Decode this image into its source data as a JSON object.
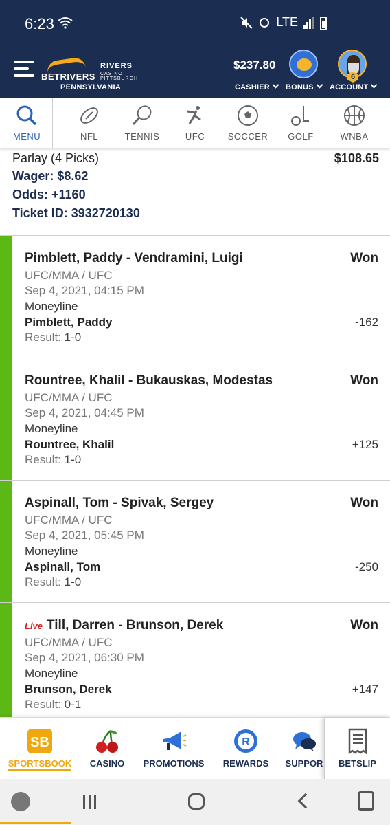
{
  "status_bar": {
    "time": "6:23",
    "network": "LTE"
  },
  "header": {
    "brand": "BETRIVERS",
    "partner_name": "RIVERS",
    "partner_sub": "CASINO PITTSBURGH",
    "state": "PENNSYLVANIA",
    "balance": "$237.80",
    "cashier_label": "CASHIER",
    "bonus_label": "BONUS",
    "account_label": "ACCOUNT",
    "level": "6"
  },
  "sport_nav": [
    {
      "label": "MENU",
      "icon": "search-icon"
    },
    {
      "label": "NFL",
      "icon": "football-icon"
    },
    {
      "label": "TENNIS",
      "icon": "tennis-icon"
    },
    {
      "label": "UFC",
      "icon": "ufc-icon"
    },
    {
      "label": "SOCCER",
      "icon": "soccer-icon"
    },
    {
      "label": "GOLF",
      "icon": "golf-icon"
    },
    {
      "label": "WNBA",
      "icon": "basketball-icon"
    }
  ],
  "bet": {
    "title": "Parlay (4 Picks)",
    "payout": "$108.65",
    "wager_label": "Wager:",
    "wager": "$8.62",
    "odds_label": "Odds:",
    "odds": "+1160",
    "ticket_label": "Ticket ID:",
    "ticket_id": "3932720130"
  },
  "legs": [
    {
      "event": "Pimblett, Paddy - Vendramini, Luigi",
      "live": "",
      "status": "Won",
      "league": "UFC/MMA / UFC",
      "datetime": "Sep 4, 2021, 04:15 PM",
      "market": "Moneyline",
      "pick": "Pimblett, Paddy",
      "odds": "-162",
      "result_label": "Result:",
      "result": "1-0"
    },
    {
      "event": "Rountree, Khalil - Bukauskas, Modestas",
      "live": "",
      "status": "Won",
      "league": "UFC/MMA / UFC",
      "datetime": "Sep 4, 2021, 04:45 PM",
      "market": "Moneyline",
      "pick": "Rountree, Khalil",
      "odds": "+125",
      "result_label": "Result:",
      "result": "1-0"
    },
    {
      "event": "Aspinall, Tom - Spivak, Sergey",
      "live": "",
      "status": "Won",
      "league": "UFC/MMA / UFC",
      "datetime": "Sep 4, 2021, 05:45 PM",
      "market": "Moneyline",
      "pick": "Aspinall, Tom",
      "odds": "-250",
      "result_label": "Result:",
      "result": "1-0"
    },
    {
      "event": "Till, Darren - Brunson, Derek",
      "live": "Live",
      "status": "Won",
      "league": "UFC/MMA / UFC",
      "datetime": "Sep 4, 2021, 06:30 PM",
      "market": "Moneyline",
      "pick": "Brunson, Derek",
      "odds": "+147",
      "result_label": "Result:",
      "result": "0-1"
    }
  ],
  "tabs": [
    {
      "label": "SPORTSBOOK",
      "icon": "sportsbook-icon"
    },
    {
      "label": "CASINO",
      "icon": "cherries-icon"
    },
    {
      "label": "PROMOTIONS",
      "icon": "megaphone-icon"
    },
    {
      "label": "REWARDS",
      "icon": "rewards-icon"
    },
    {
      "label": "SUPPOR",
      "icon": "chat-icon"
    },
    {
      "label": "BETSLIP",
      "icon": "betslip-icon"
    }
  ],
  "colors": {
    "header": "#1c2d52",
    "won_bar": "#5cb815",
    "accent": "#f0a80f",
    "live": "#d21f1f"
  }
}
